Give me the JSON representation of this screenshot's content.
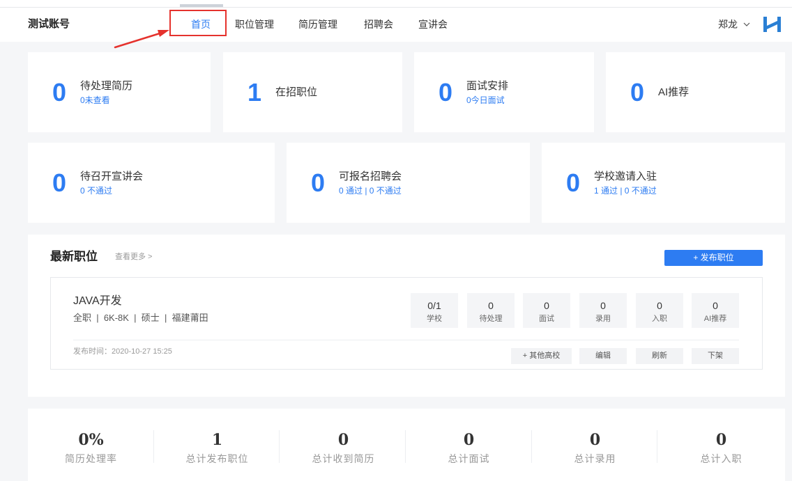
{
  "header": {
    "account": "测试账号",
    "nav": [
      {
        "label": "首页",
        "active": true
      },
      {
        "label": "职位管理",
        "active": false
      },
      {
        "label": "简历管理",
        "active": false
      },
      {
        "label": "招聘会",
        "active": false
      },
      {
        "label": "宣讲会",
        "active": false
      }
    ],
    "user": "郑龙"
  },
  "icons": {
    "user_menu": "chevron-down-icon",
    "logo": "brand-logo-icon",
    "annotation": "arrow-icon"
  },
  "colors": {
    "accent": "#2d7cf2",
    "annotation": "#e5322d",
    "logo": "#2a7fd4"
  },
  "overview": {
    "row1": [
      {
        "value": "0",
        "label": "待处理简历",
        "sub": "0未查看"
      },
      {
        "value": "1",
        "label": "在招职位"
      },
      {
        "value": "0",
        "label": "面试安排",
        "sub": "0今日面试"
      },
      {
        "value": "0",
        "label": "AI推荐"
      }
    ],
    "row2": [
      {
        "value": "0",
        "label": "待召开宣讲会",
        "sub": "0 不通过"
      },
      {
        "value": "0",
        "label": "可报名招聘会",
        "sub": "0 通过 | 0 不通过"
      },
      {
        "value": "0",
        "label": "学校邀请入驻",
        "sub": "1 通过 | 0 不通过"
      }
    ]
  },
  "latest_jobs": {
    "title": "最新职位",
    "more": "查看更多 >",
    "publish_button": "+ 发布职位",
    "jobs": [
      {
        "name": "JAVA开发",
        "meta": "全职  |  6K-8K  |  硕士  |  福建莆田",
        "stats": [
          {
            "value": "0/1",
            "label": "学校"
          },
          {
            "value": "0",
            "label": "待处理"
          },
          {
            "value": "0",
            "label": "面试"
          },
          {
            "value": "0",
            "label": "录用"
          },
          {
            "value": "0",
            "label": "入职"
          },
          {
            "value": "0",
            "label": "AI推荐"
          }
        ],
        "published": "发布时间：2020-10-27 15:25",
        "actions": [
          "+ 其他高校",
          "编辑",
          "刷新",
          "下架"
        ]
      }
    ]
  },
  "summary": [
    {
      "value": "0%",
      "label": "简历处理率"
    },
    {
      "value": "1",
      "label": "总计发布职位"
    },
    {
      "value": "0",
      "label": "总计收到简历"
    },
    {
      "value": "0",
      "label": "总计面试"
    },
    {
      "value": "0",
      "label": "总计录用"
    },
    {
      "value": "0",
      "label": "总计入职"
    }
  ]
}
